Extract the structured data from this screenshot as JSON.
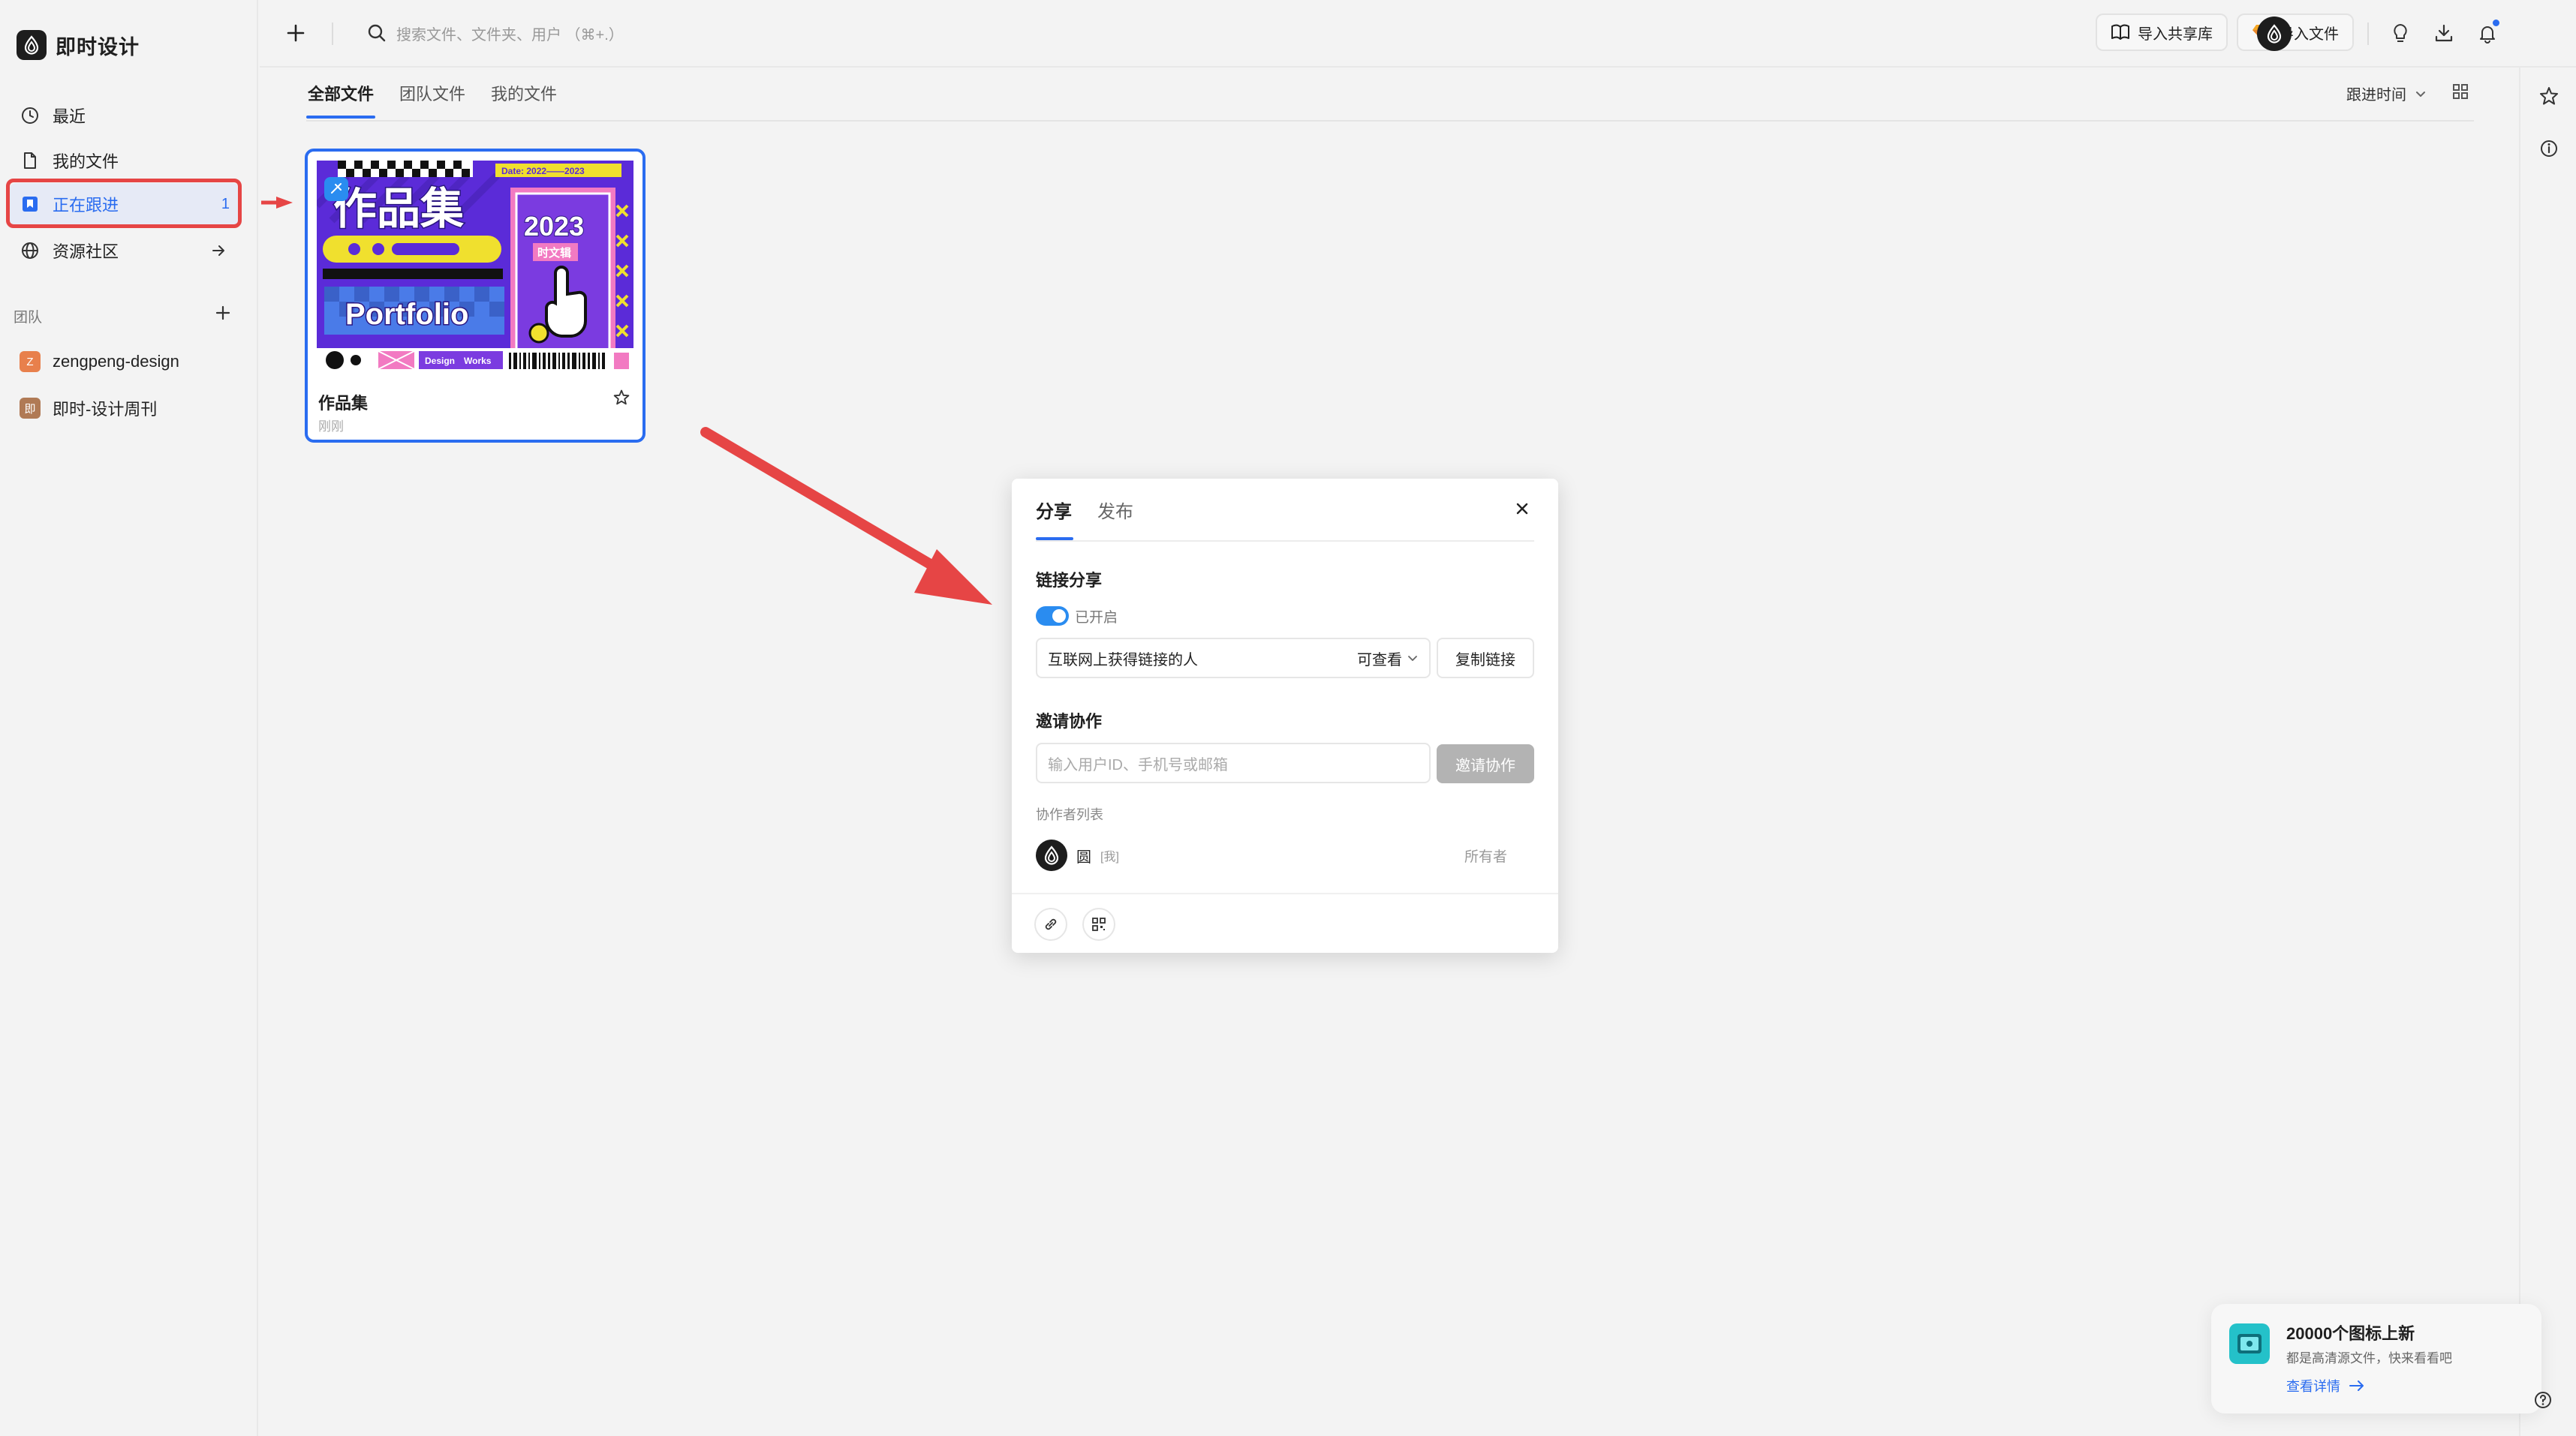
{
  "app": {
    "name": "即时设计"
  },
  "sidebar": {
    "nav": [
      {
        "label": "最近",
        "icon": "clock-icon"
      },
      {
        "label": "我的文件",
        "icon": "file-icon"
      },
      {
        "label": "正在跟进",
        "icon": "bookmark-icon",
        "count": "1",
        "active": true
      },
      {
        "label": "资源社区",
        "icon": "globe-icon"
      }
    ],
    "team_section_label": "团队",
    "teams": [
      {
        "label": "zengpeng-design",
        "badge": "Z",
        "color": "#e8804c"
      },
      {
        "label": "即时-设计周刊",
        "badge": "即",
        "color": "#b07a55"
      }
    ]
  },
  "topbar": {
    "search_placeholder": "搜索文件、文件夹、用户 （⌘+.）",
    "import_library_label": "导入共享库",
    "import_file_label": "导入文件"
  },
  "tabs": [
    {
      "label": "全部文件",
      "active": true
    },
    {
      "label": "团队文件"
    },
    {
      "label": "我的文件"
    }
  ],
  "sort_label": "跟进时间",
  "file": {
    "title": "作品集",
    "subtitle": "刚刚",
    "thumbnail": {
      "headline": "作品集",
      "year": "2023",
      "date": "Date: 2022——2023",
      "word": "Portfolio",
      "tag": "时文辑",
      "footer_left": "Design",
      "footer_right": "Works"
    }
  },
  "dialog": {
    "tabs": [
      "分享",
      "发布"
    ],
    "link_share_title": "链接分享",
    "toggle_label": "已开启",
    "link_scope": "互联网上获得链接的人",
    "permission": "可查看",
    "copy_link_label": "复制链接",
    "invite_title": "邀请协作",
    "invite_placeholder": "输入用户ID、手机号或邮箱",
    "invite_button": "邀请协作",
    "collaborators_label": "协作者列表",
    "collaborator": {
      "name": "圆",
      "me_tag": "[我]",
      "role": "所有者"
    }
  },
  "toast": {
    "title": "20000个图标上新",
    "description": "都是高清源文件，快来看看吧",
    "link": "查看详情"
  },
  "colors": {
    "accent": "#2a6cf0",
    "annotation": "#e64545"
  }
}
